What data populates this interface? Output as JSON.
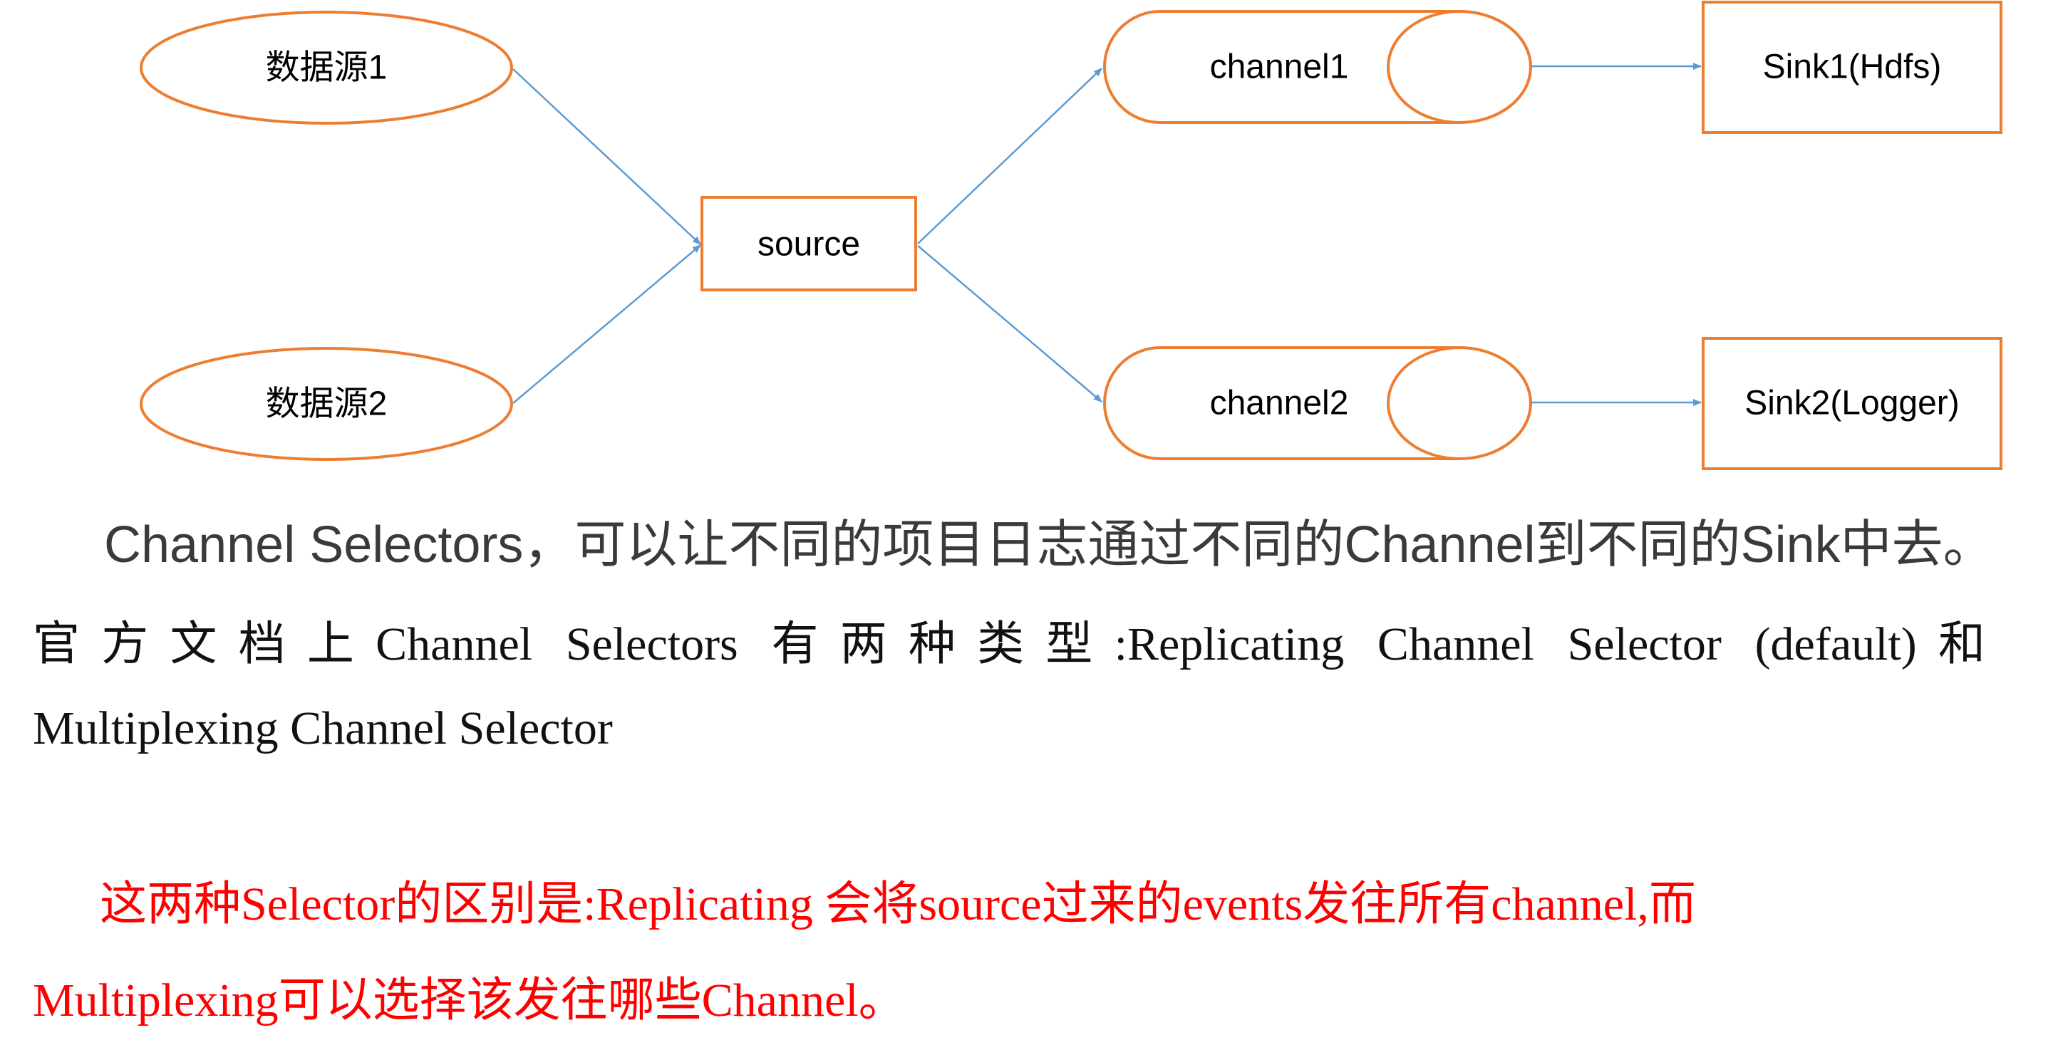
{
  "diagram": {
    "nodes": {
      "source1": "数据源1",
      "source2": "数据源2",
      "source": "source",
      "channel1": "channel1",
      "channel2": "channel2",
      "sink1": "Sink1(Hdfs)",
      "sink2": "Sink2(Logger)"
    },
    "colors": {
      "node_stroke": "#ED7D31",
      "arrow": "#5B9BD5",
      "text": "#000000"
    }
  },
  "paragraphs": {
    "intro": "Channel Selectors，可以让不同的项目日志通过不同的Channel到不同的Sink中去。",
    "docs_line1": "官方文档上Channel Selectors 有两种类型:Replicating Channel Selector (default)和",
    "docs_line2": "Multiplexing Channel Selector",
    "diff_line1": "这两种Selector的区别是:Replicating  会将source过来的events发往所有channel,而",
    "diff_line2": "Multiplexing可以选择该发往哪些Channel。"
  },
  "colors": {
    "intro_text": "#3a3a3a",
    "body_text": "#111111",
    "highlight_text": "#ff0000"
  }
}
